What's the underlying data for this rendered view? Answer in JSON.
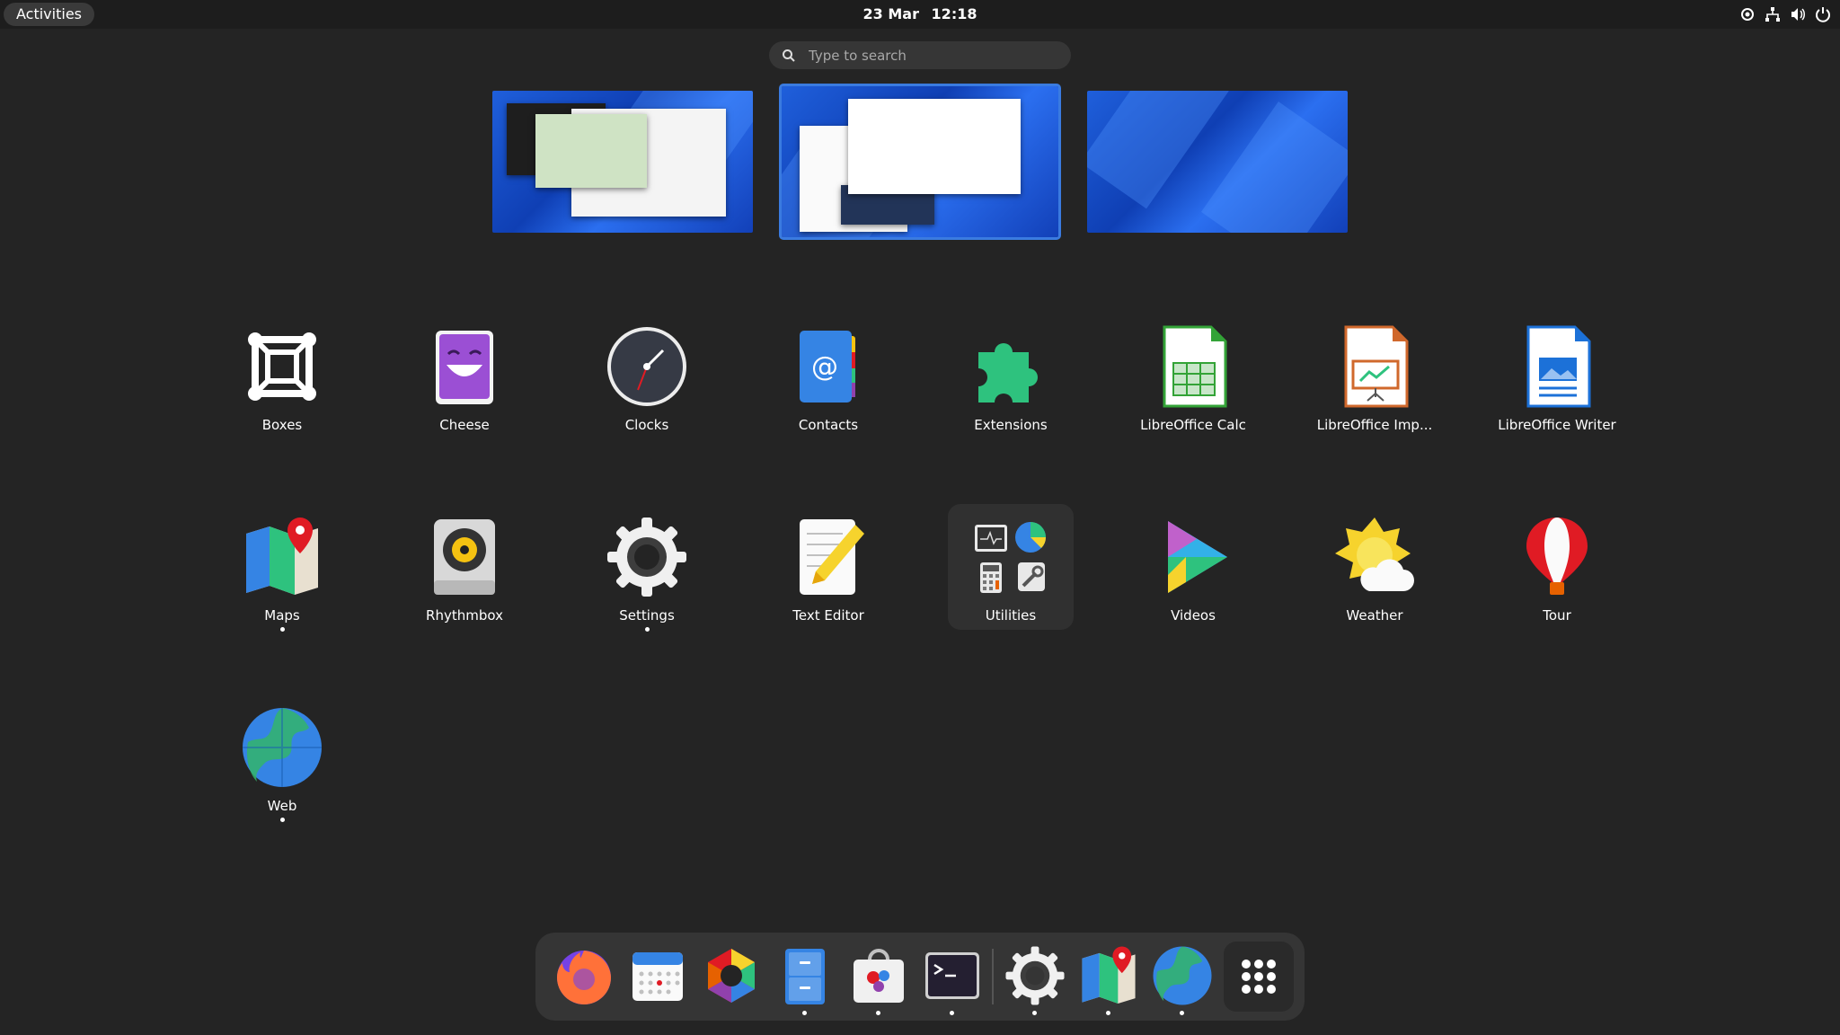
{
  "topbar": {
    "activities_label": "Activities",
    "date": "23 Mar",
    "time": "12:18",
    "status_icons": [
      "location-icon",
      "network-icon",
      "volume-icon",
      "power-icon"
    ]
  },
  "search": {
    "placeholder": "Type to search"
  },
  "workspaces": [
    "workspace-1",
    "workspace-2",
    "workspace-3"
  ],
  "apps": [
    {
      "label": "Boxes",
      "icon": "boxes-icon",
      "running": false
    },
    {
      "label": "Cheese",
      "icon": "cheese-icon",
      "running": false
    },
    {
      "label": "Clocks",
      "icon": "clocks-icon",
      "running": false
    },
    {
      "label": "Contacts",
      "icon": "contacts-icon",
      "running": false
    },
    {
      "label": "Extensions",
      "icon": "extensions-icon",
      "running": false
    },
    {
      "label": "LibreOffice Calc",
      "icon": "libreoffice-calc-icon",
      "running": false
    },
    {
      "label": "LibreOffice Imp...",
      "icon": "libreoffice-impress-icon",
      "running": false
    },
    {
      "label": "LibreOffice Writer",
      "icon": "libreoffice-writer-icon",
      "running": false
    },
    {
      "label": "Maps",
      "icon": "maps-icon",
      "running": true
    },
    {
      "label": "Rhythmbox",
      "icon": "rhythmbox-icon",
      "running": false
    },
    {
      "label": "Settings",
      "icon": "settings-icon",
      "running": true
    },
    {
      "label": "Text Editor",
      "icon": "text-editor-icon",
      "running": false
    },
    {
      "label": "Utilities",
      "icon": "utilities-folder-icon",
      "running": false
    },
    {
      "label": "Videos",
      "icon": "videos-icon",
      "running": false
    },
    {
      "label": "Weather",
      "icon": "weather-icon",
      "running": false
    },
    {
      "label": "Tour",
      "icon": "tour-icon",
      "running": false
    },
    {
      "label": "Web",
      "icon": "web-icon",
      "running": true
    }
  ],
  "dock": [
    {
      "icon": "firefox-icon",
      "running": false
    },
    {
      "icon": "calendar-icon",
      "running": false
    },
    {
      "icon": "photos-icon",
      "running": false
    },
    {
      "icon": "files-icon",
      "running": true
    },
    {
      "icon": "software-icon",
      "running": true
    },
    {
      "icon": "terminal-icon",
      "running": true
    },
    {
      "icon": "settings-icon",
      "running": true
    },
    {
      "icon": "maps-icon",
      "running": true
    },
    {
      "icon": "web-icon",
      "running": true
    },
    {
      "icon": "show-apps-icon",
      "running": false
    }
  ],
  "colors": {
    "background": "#242424",
    "topbar": "#1d1d1d",
    "dock": "#353535",
    "accent": "#3584e4"
  }
}
